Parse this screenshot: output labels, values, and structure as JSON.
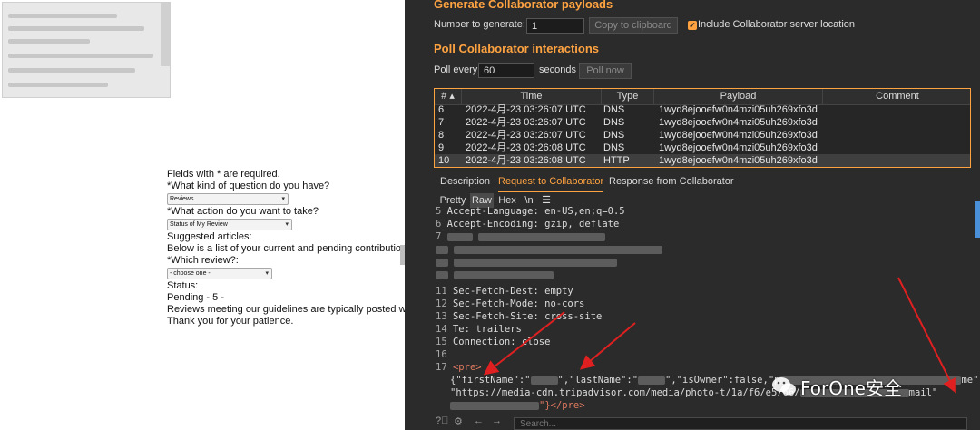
{
  "web_form": {
    "required_note": "Fields with * are required.",
    "question_kind_label": "*What kind of question do you have?",
    "question_kind_value": "Reviews",
    "action_label": "*What action do you want to take?",
    "action_value": "Status of My Review",
    "suggested_label": "Suggested articles:",
    "contrib_text": "Below is a list of your current and pending contributions",
    "which_review_label": "*Which review?:",
    "which_review_value": "- choose one -",
    "status_label": "Status:",
    "status_value": "Pending - 5 -",
    "guidelines_text": "Reviews meeting our guidelines are typically posted with",
    "thanks_text": "Thank you for your patience."
  },
  "burp": {
    "generate_title": "Generate Collaborator payloads",
    "number_label": "Number to generate:",
    "number_value": "1",
    "copy_button": "Copy to clipboard",
    "include_label": "Include Collaborator server location",
    "poll_title": "Poll Collaborator interactions",
    "poll_every_label": "Poll every",
    "poll_every_value": "60",
    "seconds_label": "seconds",
    "poll_now_button": "Poll now",
    "table": {
      "headers": [
        "# ▴",
        "Time",
        "Type",
        "Payload",
        "Comment"
      ],
      "rows": [
        [
          "6",
          "2022-4月-23 03:26:07 UTC",
          "DNS",
          "1wyd8ejooefw0n4mzi05uh269xfo3d",
          ""
        ],
        [
          "7",
          "2022-4月-23 03:26:07 UTC",
          "DNS",
          "1wyd8ejooefw0n4mzi05uh269xfo3d",
          ""
        ],
        [
          "8",
          "2022-4月-23 03:26:07 UTC",
          "DNS",
          "1wyd8ejooefw0n4mzi05uh269xfo3d",
          ""
        ],
        [
          "9",
          "2022-4月-23 03:26:08 UTC",
          "DNS",
          "1wyd8ejooefw0n4mzi05uh269xfo3d",
          ""
        ],
        [
          "10",
          "2022-4月-23 03:26:08 UTC",
          "HTTP",
          "1wyd8ejooefw0n4mzi05uh269xfo3d",
          ""
        ]
      ]
    },
    "tabs": [
      "Description",
      "Request to Collaborator",
      "Response from Collaborator"
    ],
    "subtabs": [
      "Pretty",
      "Raw",
      "Hex",
      "\\n",
      "☰"
    ],
    "code_lines": {
      "l5_num": "5",
      "l5": "Accept-Language: en-US,en;q=0.5",
      "l6_num": "6",
      "l6": "Accept-Encoding: gzip, deflate",
      "l7_num": "7",
      "l11_num": "11",
      "l11": "Sec-Fetch-Dest: empty",
      "l12_num": "12",
      "l12": "Sec-Fetch-Mode: no-cors",
      "l13_num": "13",
      "l13": "Sec-Fetch-Site: cross-site",
      "l14_num": "14",
      "l14": "Te: trailers",
      "l15_num": "15",
      "l15": "Connection: close",
      "l16_num": "16",
      "l17_num": "17",
      "l17": "<pre>",
      "json1_a": "{\"firstName\":\"",
      "json1_b": "\",\"lastName\":\"",
      "json1_c": "\",\"isOwner\":false,\"p",
      "json1_d": "me\":\"ma",
      "json2_a": "\"https://media-cdn.tripadvisor.com/media/photo-t/1a/f6/e5/66/",
      "json2_b": "mail\"",
      "json3": "\"}</pre>"
    },
    "search_placeholder": "Search..."
  },
  "watermark": "ForOne安全"
}
